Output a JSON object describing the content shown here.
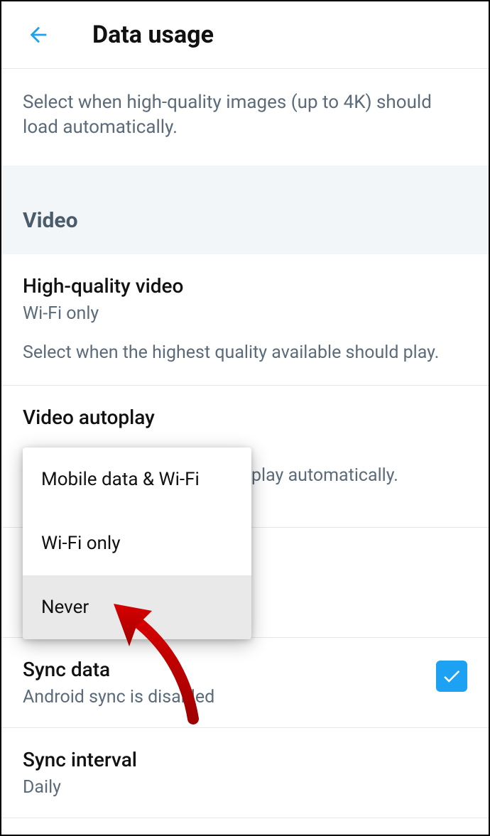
{
  "header": {
    "title": "Data usage"
  },
  "images_desc": "Select when high-quality images (up to 4K) should load automatically.",
  "video_section_title": "Video",
  "hq_video": {
    "title": "High-quality video",
    "sub": "Wi-Fi only",
    "desc": "Select when the highest quality available should play."
  },
  "autoplay": {
    "title": "Video autoplay",
    "desc_visible": "play automatically."
  },
  "menu": {
    "opt1": "Mobile data & Wi-Fi",
    "opt2": "Wi-Fi only",
    "opt3": "Never"
  },
  "sync_data": {
    "title": "Sync data",
    "sub": "Android sync is disabled",
    "checked": true
  },
  "sync_interval": {
    "title": "Sync interval",
    "sub": "Daily"
  }
}
